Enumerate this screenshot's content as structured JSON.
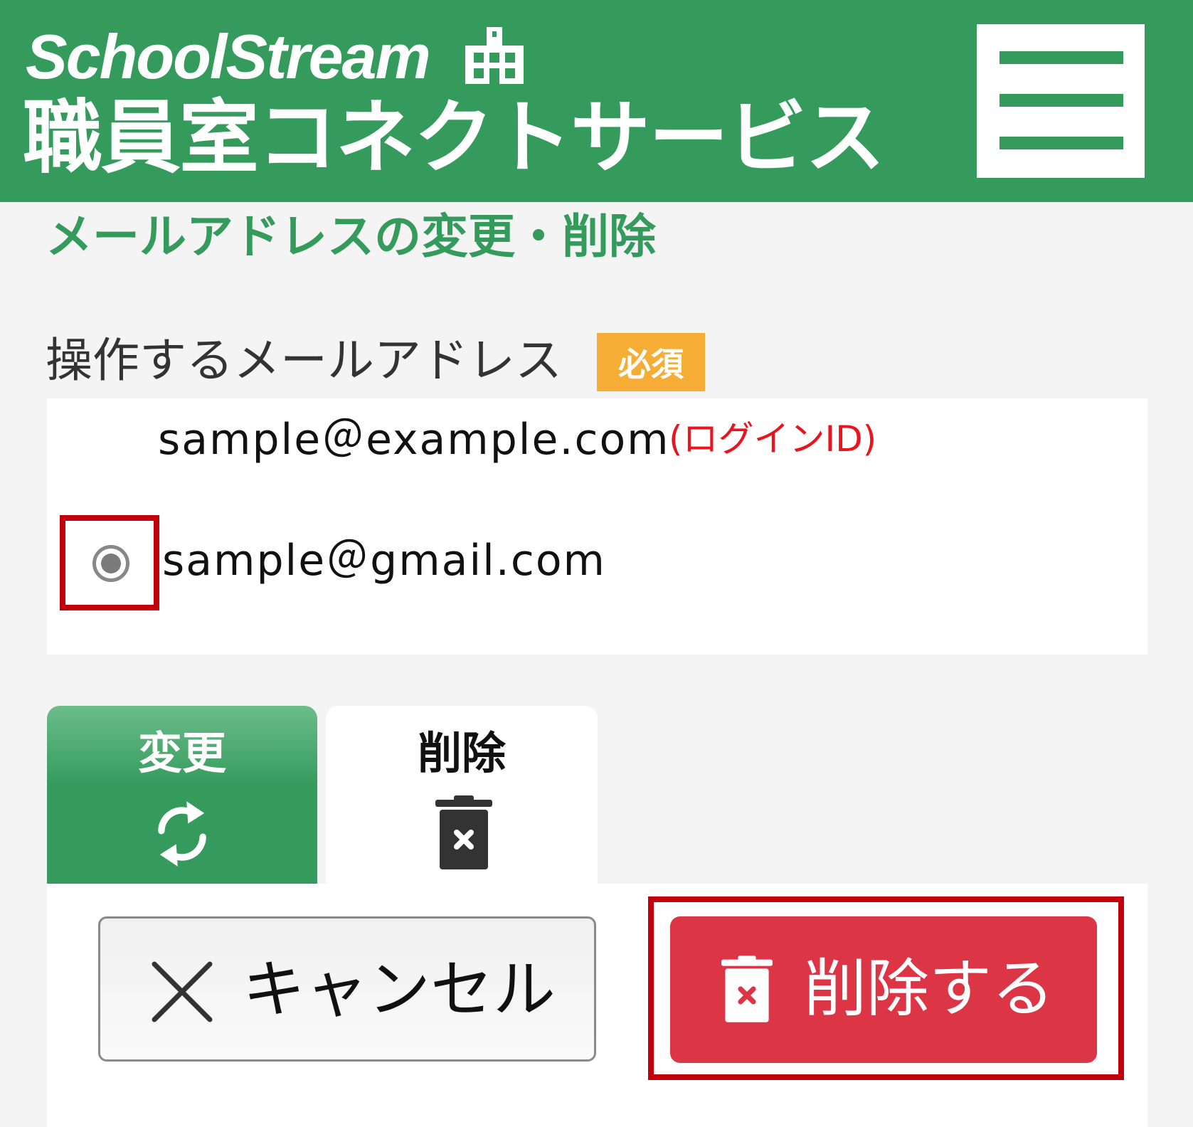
{
  "header": {
    "logo_brand": "SchoolStream",
    "logo_service": "職員室コネクトサービス",
    "menu_icon": "hamburger-menu-icon"
  },
  "page": {
    "title": "メールアドレスの変更・削除"
  },
  "form": {
    "field_label": "操作するメールアドレス",
    "required_badge": "必須",
    "addresses": [
      {
        "email": "sample＠example.com",
        "note": "(ログインID)",
        "selectable": false
      },
      {
        "email": "sample＠gmail.com",
        "selected": true
      }
    ]
  },
  "tabs": [
    {
      "label": "変更",
      "icon": "refresh-icon",
      "active": true
    },
    {
      "label": "削除",
      "icon": "trash-icon",
      "active": false
    }
  ],
  "actions": {
    "cancel_label": "キャンセル",
    "delete_label": "削除する"
  },
  "colors": {
    "brand_green": "#359b5d",
    "badge_orange": "#f6ad36",
    "danger_red": "#dc3545",
    "highlight_red": "#c0000b",
    "login_id_red": "#e8151e"
  }
}
